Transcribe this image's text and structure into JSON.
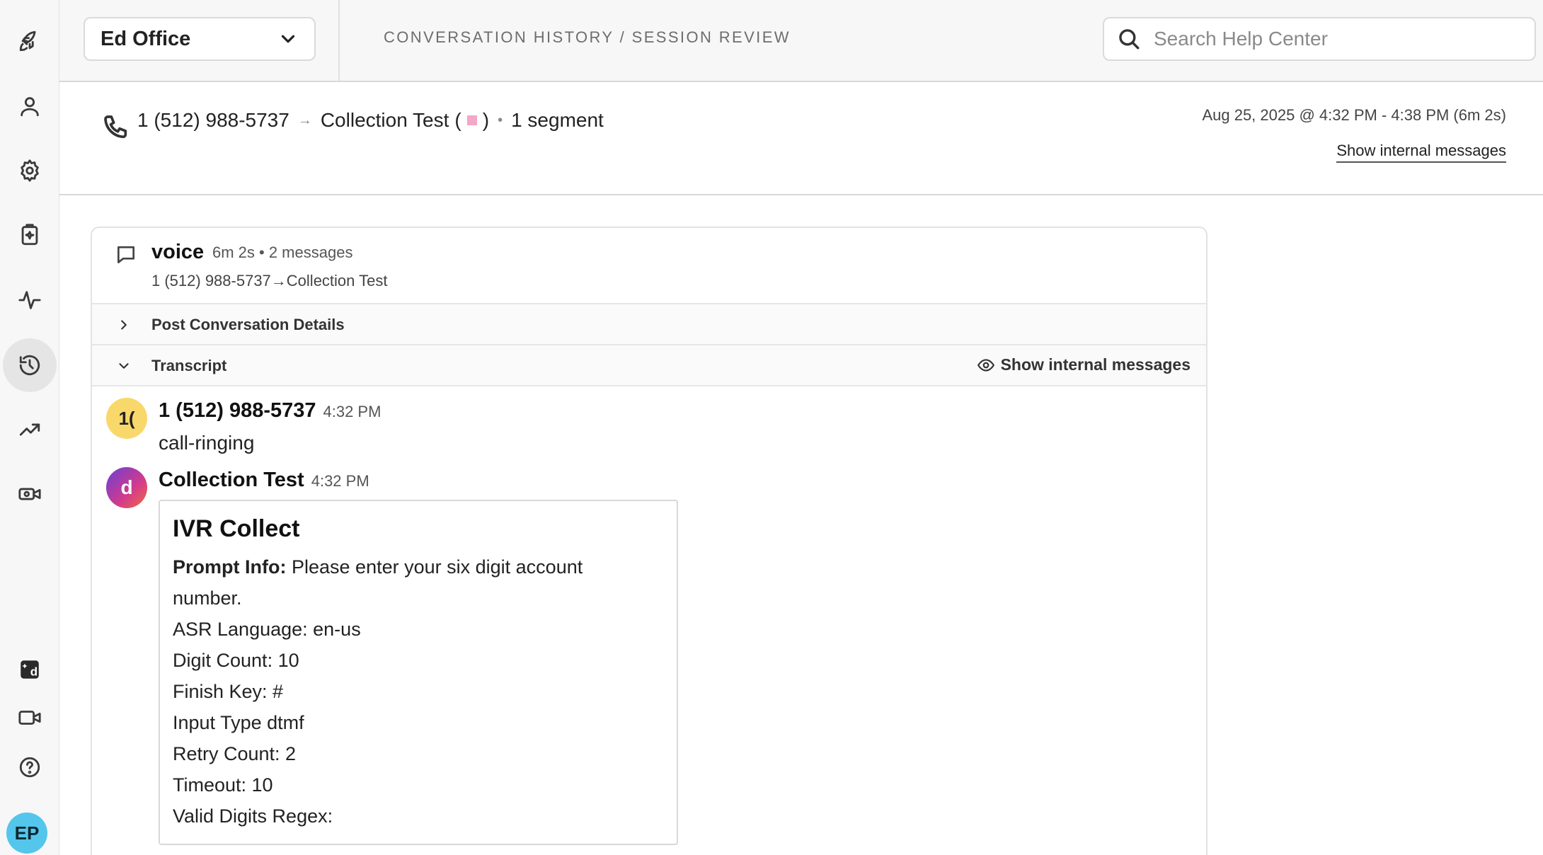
{
  "topbar": {
    "org_name": "Ed Office",
    "breadcrumb": "CONVERSATION HISTORY / SESSION REVIEW",
    "search_placeholder": "Search Help Center"
  },
  "rail": {
    "user_initials": "EP",
    "active_item": "history-icon"
  },
  "session": {
    "from": "1 (512) 988-5737",
    "arrow": "→",
    "to": "Collection Test",
    "open_paren": "(",
    "close_paren": ")",
    "separator": "•",
    "segments": "1 segment",
    "time_range": "Aug 25, 2025 @ 4:32 PM - 4:38 PM (6m 2s)",
    "show_internal_label": "Show internal messages",
    "tag_color": "#f4a7c6"
  },
  "segment": {
    "channel": "voice",
    "meta": "6m 2s • 2 messages",
    "route": "1 (512) 988-5737→Collection Test",
    "post_details_label": "Post Conversation Details",
    "transcript_label": "Transcript",
    "show_internal_label": "Show internal messages"
  },
  "messages": [
    {
      "avatar_text": "1(",
      "avatar_color": "#f9d86b",
      "sender": "1 (512) 988-5737",
      "time": "4:32 PM",
      "text": "call-ringing"
    },
    {
      "avatar_text": "d",
      "avatar_color": "#8e3fc4",
      "sender": "Collection Test",
      "time": "4:32 PM",
      "card": {
        "title": "IVR Collect",
        "prompt_label": "Prompt Info:",
        "prompt_value": "Please enter your six digit account",
        "prompt_value_cont": "number.",
        "lines": [
          "ASR Language: en-us",
          "Digit Count: 10",
          "Finish Key: #",
          "Input Type dtmf",
          "Retry Count: 2",
          "Timeout: 10",
          "Valid Digits Regex:"
        ]
      }
    }
  ]
}
